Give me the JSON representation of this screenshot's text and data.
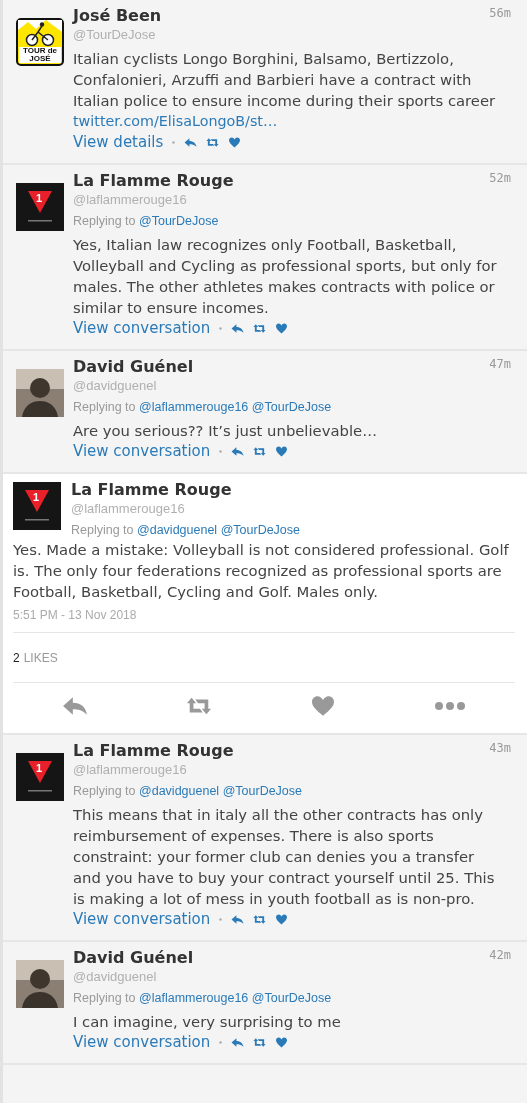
{
  "tweets": [
    {
      "kind": "compact",
      "avatar": {
        "kind": "tour"
      },
      "avatar_label": "TOUR de JOSÉ",
      "name": "José Been",
      "handle": "@TourDeJose",
      "time": "56m",
      "text": "Italian cyclists Longo Borghini, Balsamo, Bertizzolo, Confalonieri, Arzuffi and Barbieri have a contract with Italian police to ensure income during their sports career",
      "link": "twitter.com/ElisaLongoB/st…",
      "action": "View details"
    },
    {
      "kind": "compact",
      "avatar": {
        "kind": "flamme"
      },
      "avatar_label": "1",
      "name": "La Flamme Rouge",
      "handle": "@laflammerouge16",
      "time": "52m",
      "replying_label": "Replying to",
      "replying_to": [
        "@TourDeJose"
      ],
      "text": "Yes, Italian law recognizes only Football, Basketball, Volleyball and Cycling as professional sports, but only for males. The other athletes makes contracts with police or similar to ensure incomes.",
      "action": "View conversation"
    },
    {
      "kind": "compact",
      "avatar": {
        "kind": "photo"
      },
      "name": "David Guénel",
      "handle": "@davidguenel",
      "time": "47m",
      "replying_label": "Replying to",
      "replying_to": [
        "@laflammerouge16",
        "@TourDeJose"
      ],
      "text": "Are you serious?? It’s just unbelievable…",
      "action": "View conversation"
    },
    {
      "kind": "focused",
      "avatar": {
        "kind": "flamme"
      },
      "avatar_label": "1",
      "name": "La Flamme Rouge",
      "handle": "@laflammerouge16",
      "replying_label": "Replying to",
      "replying_to": [
        "@davidguenel",
        "@TourDeJose"
      ],
      "text": "Yes. Made a mistake: Volleyball is not considered professional. Golf is. The only four federations recognized as professional sports are Football, Basketball, Cycling and Golf. Males only.",
      "timestamp": "5:51 PM - 13 Nov 2018",
      "likes_count": "2",
      "likes_label": "LIKES"
    },
    {
      "kind": "compact",
      "avatar": {
        "kind": "flamme"
      },
      "avatar_label": "1",
      "name": "La Flamme Rouge",
      "handle": "@laflammerouge16",
      "time": "43m",
      "replying_label": "Replying to",
      "replying_to": [
        "@davidguenel",
        "@TourDeJose"
      ],
      "text": "This means that in italy all the other contracts has only reimbursement of expenses. There is also sports constraint: your former club can denies you a transfer and you have to buy your contract yourself until 25. This is making a lot of mess in youth football as is non-pro.",
      "action": "View conversation"
    },
    {
      "kind": "compact",
      "avatar": {
        "kind": "photo"
      },
      "name": "David Guénel",
      "handle": "@davidguenel",
      "time": "42m",
      "replying_label": "Replying to",
      "replying_to": [
        "@laflammerouge16",
        "@TourDeJose"
      ],
      "text": "I can imagine, very surprising to me",
      "action": "View conversation"
    }
  ]
}
